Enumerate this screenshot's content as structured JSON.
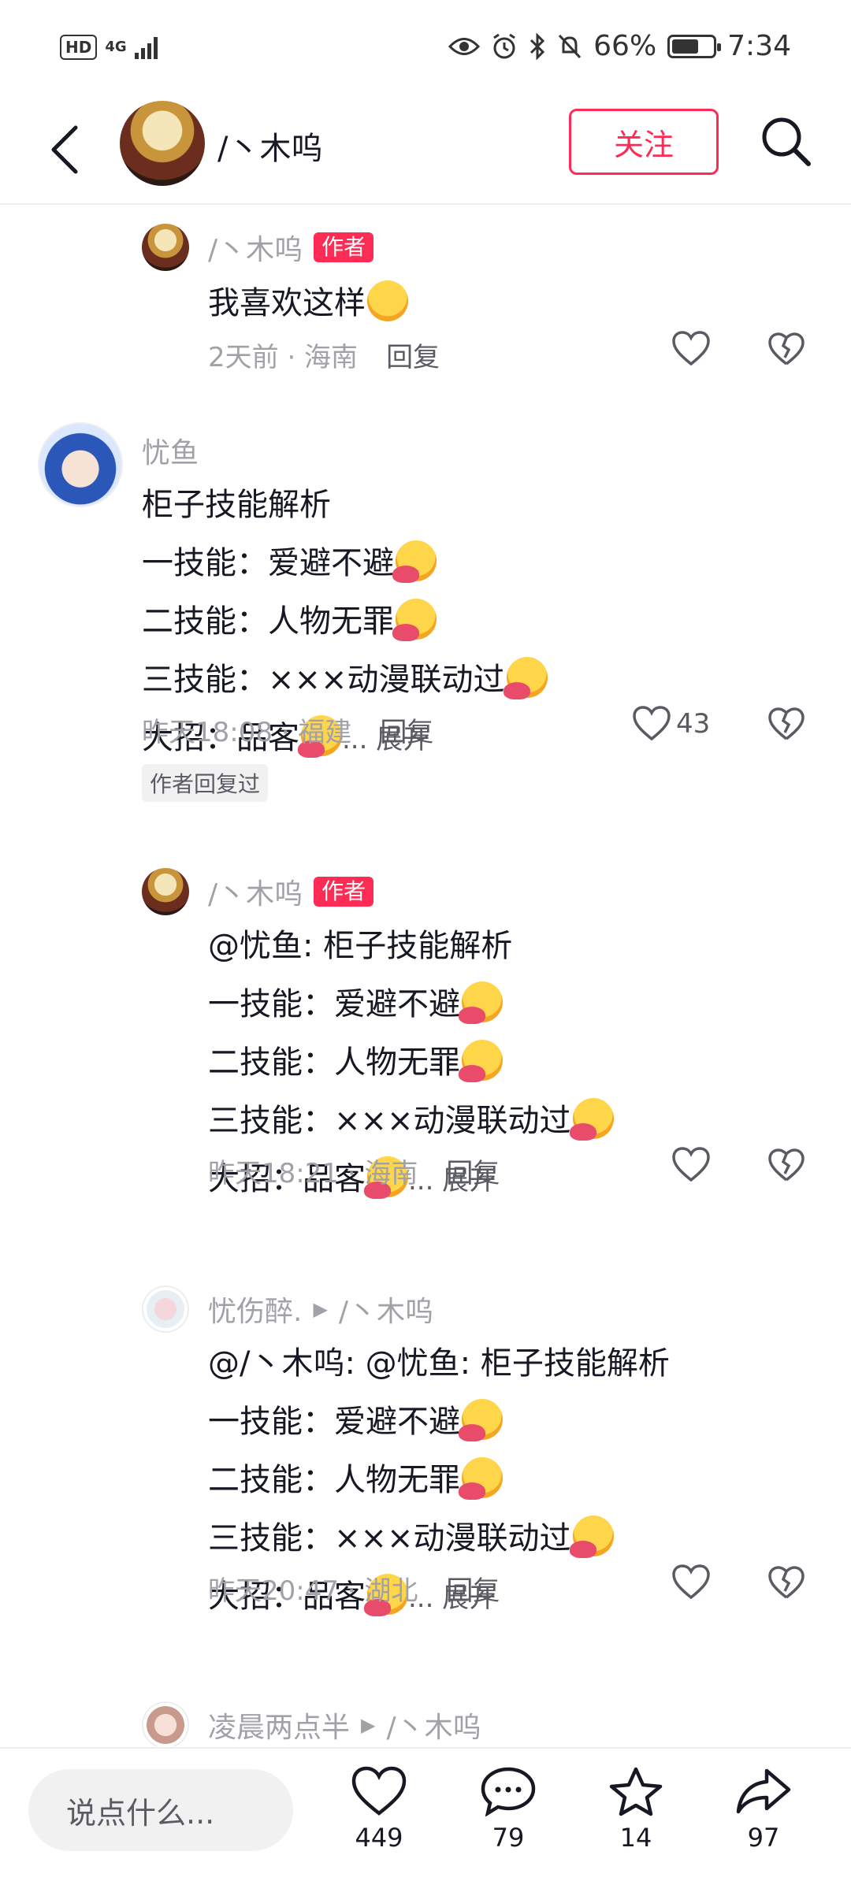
{
  "status_bar": {
    "hd_label": "HD",
    "network_type": "4G",
    "battery_text": "66%",
    "battery_level": 0.66,
    "time": "7:34"
  },
  "header": {
    "title": "/丶木呜",
    "follow_label": "关注"
  },
  "comments": [
    {
      "author": "/丶木呜",
      "author_badge": "作者",
      "lines": [
        "我喜欢这样"
      ],
      "time_location": "2天前 · 海南",
      "reply_label": "回复",
      "like_count": ""
    },
    {
      "author": "忧鱼",
      "lines": [
        "柜子技能解析",
        "一技能：爱避不避",
        "二技能：人物无罪",
        "三技能：×××动漫联动过",
        "大招：品客"
      ],
      "expand_label": "... 展开",
      "time_location": "昨天18:08 · 福建",
      "reply_label": "回复",
      "like_count": "43",
      "replied_tag": "作者回复过"
    },
    {
      "author": "/丶木呜",
      "author_badge": "作者",
      "lines": [
        "@忧鱼: 柜子技能解析",
        "一技能：爱避不避",
        "二技能：人物无罪",
        "三技能：×××动漫联动过",
        "大招：品客"
      ],
      "expand_label": "... 展开",
      "time_location": "昨天18:21 · 海南",
      "reply_label": "回复"
    },
    {
      "author": "忧伤醉.",
      "reply_to": "/丶木呜",
      "lines": [
        "@/丶木呜: @忧鱼: 柜子技能解析",
        "一技能：爱避不避",
        "二技能：人物无罪",
        "三技能：×××动漫联动过",
        "大招：品客"
      ],
      "expand_label": "... 展开",
      "time_location": "昨天20:47 · 湖北",
      "reply_label": "回复"
    },
    {
      "author": "凌晨两点半",
      "reply_to": "/丶木呜"
    }
  ],
  "bottom_bar": {
    "input_placeholder": "说点什么...",
    "like_count": "449",
    "comment_count": "79",
    "favorite_count": "14",
    "share_count": "97"
  },
  "icons": {
    "back": "chevron-left-icon",
    "search": "search-icon",
    "like": "heart-icon",
    "dislike": "broken-heart-icon",
    "comment": "speech-bubble-icon",
    "favorite": "star-icon",
    "share": "share-arrow-icon"
  },
  "colors": {
    "accent": "#fe2c55",
    "text": "#161823",
    "secondary": "#a1a2a7"
  }
}
